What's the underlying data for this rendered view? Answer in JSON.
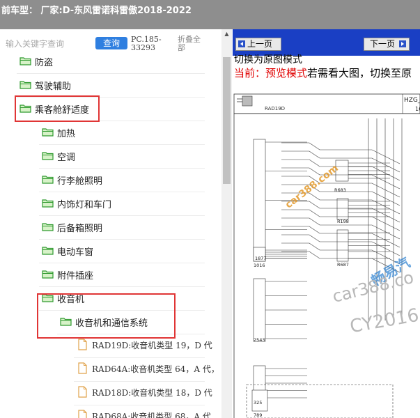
{
  "header": {
    "title": "前车型：  厂家:D-东风雷诺科雷傲2018-2022"
  },
  "search": {
    "placeholder": "输入关键字查询",
    "query_label": "查询",
    "pc_code": "PC.185-33293",
    "collapse_label": "折叠全部"
  },
  "tree": [
    {
      "label": "防盗",
      "type": "folder",
      "level": 1
    },
    {
      "label": "驾驶辅助",
      "type": "folder",
      "level": 1
    },
    {
      "label": "乘客舱舒适度",
      "type": "folder",
      "level": 1,
      "highlighted": true
    },
    {
      "label": "加热",
      "type": "folder",
      "level": 2
    },
    {
      "label": "空调",
      "type": "folder",
      "level": 2
    },
    {
      "label": "行李舱照明",
      "type": "folder",
      "level": 2
    },
    {
      "label": "内饰灯和车门",
      "type": "folder",
      "level": 2
    },
    {
      "label": "后备箱照明",
      "type": "folder",
      "level": 2
    },
    {
      "label": "电动车窗",
      "type": "folder",
      "level": 2
    },
    {
      "label": "附件插座",
      "type": "folder",
      "level": 2
    },
    {
      "label": "收音机",
      "type": "folder",
      "level": 2,
      "highlighted": true
    },
    {
      "label": "收音机和通信系统",
      "type": "folder",
      "level": 3,
      "highlighted": true
    },
    {
      "label": "RAD19D:收音机类型 19，D 代",
      "type": "doc",
      "level": 4
    },
    {
      "label": "RAD64A:收音机类型 64，A 代，",
      "type": "doc",
      "level": 4
    },
    {
      "label": "RAD18D:收音机类型 18，D 代",
      "type": "doc",
      "level": 4
    },
    {
      "label": "RAD68A:收音机类型 68，A 代",
      "type": "doc",
      "level": 4
    }
  ],
  "viewer": {
    "prev_label": "上一页",
    "next_label": "下一页",
    "mode_line1": "切换为原图模式",
    "mode_prefix": "当前：预览模式",
    "mode_suffix": "若需看大图，切换至原",
    "diagram": {
      "header_left": "RAD19D",
      "header_right": "HZG_",
      "header_right_sub": "16",
      "components": [
        "R683",
        "R198",
        "R687",
        "1877",
        "1016",
        "2543",
        "325",
        "789"
      ],
      "watermarks": [
        "car388.com",
        "畅易汽",
        "car388.co",
        "CY2016"
      ]
    }
  },
  "colors": {
    "highlight": "#e03535",
    "nav_bg": "#1a3fc4",
    "query_btn": "#2f7fe0",
    "mode_red": "#e00000",
    "folder_fill": "#d7f2c8",
    "folder_stroke": "#2f9a2f"
  }
}
